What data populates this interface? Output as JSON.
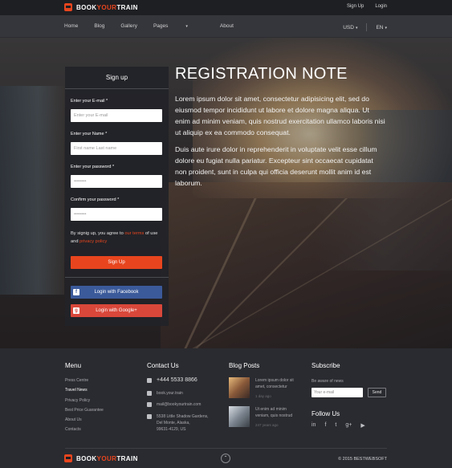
{
  "brand": {
    "name_part1": "BOOK",
    "name_part2": "YOUR",
    "name_part3": "TRAIN",
    "accent_color": "#e8451e"
  },
  "topbar": {
    "signup": "Sign Up",
    "login": "Login"
  },
  "nav": {
    "items": [
      "Home",
      "Blog",
      "Gallery",
      "Pages",
      "About"
    ],
    "currency": "USD",
    "language": "EN"
  },
  "signup": {
    "title": "Sign up",
    "email_label": "Enter your E-mail *",
    "email_placeholder": "Enter your E-mail",
    "name_label": "Enter your Name *",
    "name_placeholder": "First name Last name",
    "password_label": "Enter your password *",
    "password_value": "••••••••",
    "confirm_label": "Confirm your password *",
    "confirm_value": "••••••••",
    "agree_prefix": "By signig up, you agree to ",
    "terms_link": "our terms",
    "agree_mid": " of use and ",
    "privacy_link": "privacy policy",
    "submit": "Sign Up",
    "facebook": "Login with Facebook",
    "google": "Login with Google+"
  },
  "hero": {
    "title": "REGISTRATION NOTE",
    "para1": "Lorem ipsum dolor sit amet, consectetur adipisicing elit, sed do eiusmod tempor incididunt ut labore et dolore magna aliqua. Ut enim ad minim veniam, quis nostrud exercitation ullamco laboris nisi ut aliquip ex ea commodo consequat.",
    "para2": "Duis aute irure dolor in reprehenderit in voluptate velit esse cillum dolore eu fugiat nulla pariatur. Excepteur sint occaecat cupidatat non proident, sunt in culpa qui officia deserunt mollit anim id est laborum."
  },
  "footer": {
    "menu_title": "Menu",
    "menu": [
      "Press Centre",
      "Travel News",
      "Privacy Policy",
      "Best Price Guarantee",
      "About Us",
      "Contacts"
    ],
    "contact_title": "Contact Us",
    "phone": "+444 5533 8866",
    "skype": "book.your.train",
    "email": "mail@bookyourtrain.com",
    "address_l1": "5538 Little Shadow Gardens,",
    "address_l2": "Del Monte, Alaska,",
    "address_l3": "99631-4129, US",
    "blog_title": "Blog Posts",
    "posts": [
      {
        "text": "Lorem ipsum dolor sit amet, consectetur",
        "date": "1 day ago"
      },
      {
        "text": "Ut enim ad minim veniam, quis nostrud",
        "date": "247 years ago"
      }
    ],
    "subscribe_title": "Subscribe",
    "subscribe_label": "Be aware of news",
    "subscribe_placeholder": "Your e-mail",
    "subscribe_button": "Send",
    "follow_title": "Follow Us",
    "social_icons": [
      "in",
      "f",
      "t",
      "g+",
      "▶"
    ],
    "copyright": "© 2015 BESTWEBSOFT"
  }
}
